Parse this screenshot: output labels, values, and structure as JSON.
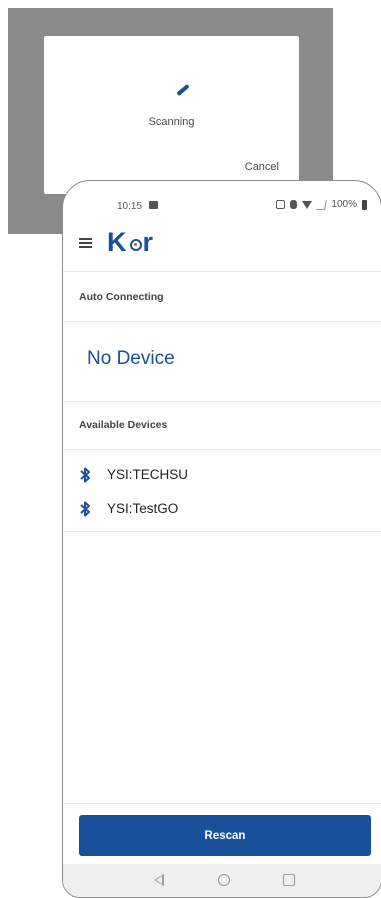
{
  "dialog": {
    "status_text": "Scanning",
    "cancel_label": "Cancel"
  },
  "status_bar": {
    "time": "10:15",
    "battery": "100%"
  },
  "app": {
    "logo_k": "K",
    "logo_r": "r",
    "brand_color": "#1a4f9a"
  },
  "auto_connecting": {
    "label": "Auto Connecting",
    "value": "No Device"
  },
  "available_devices": {
    "label": "Available Devices",
    "items": [
      {
        "name": "YSI:TECHSU",
        "icon": "bluetooth-icon"
      },
      {
        "name": "YSI:TestGO",
        "icon": "bluetooth-icon"
      }
    ]
  },
  "actions": {
    "rescan_label": "Rescan"
  }
}
